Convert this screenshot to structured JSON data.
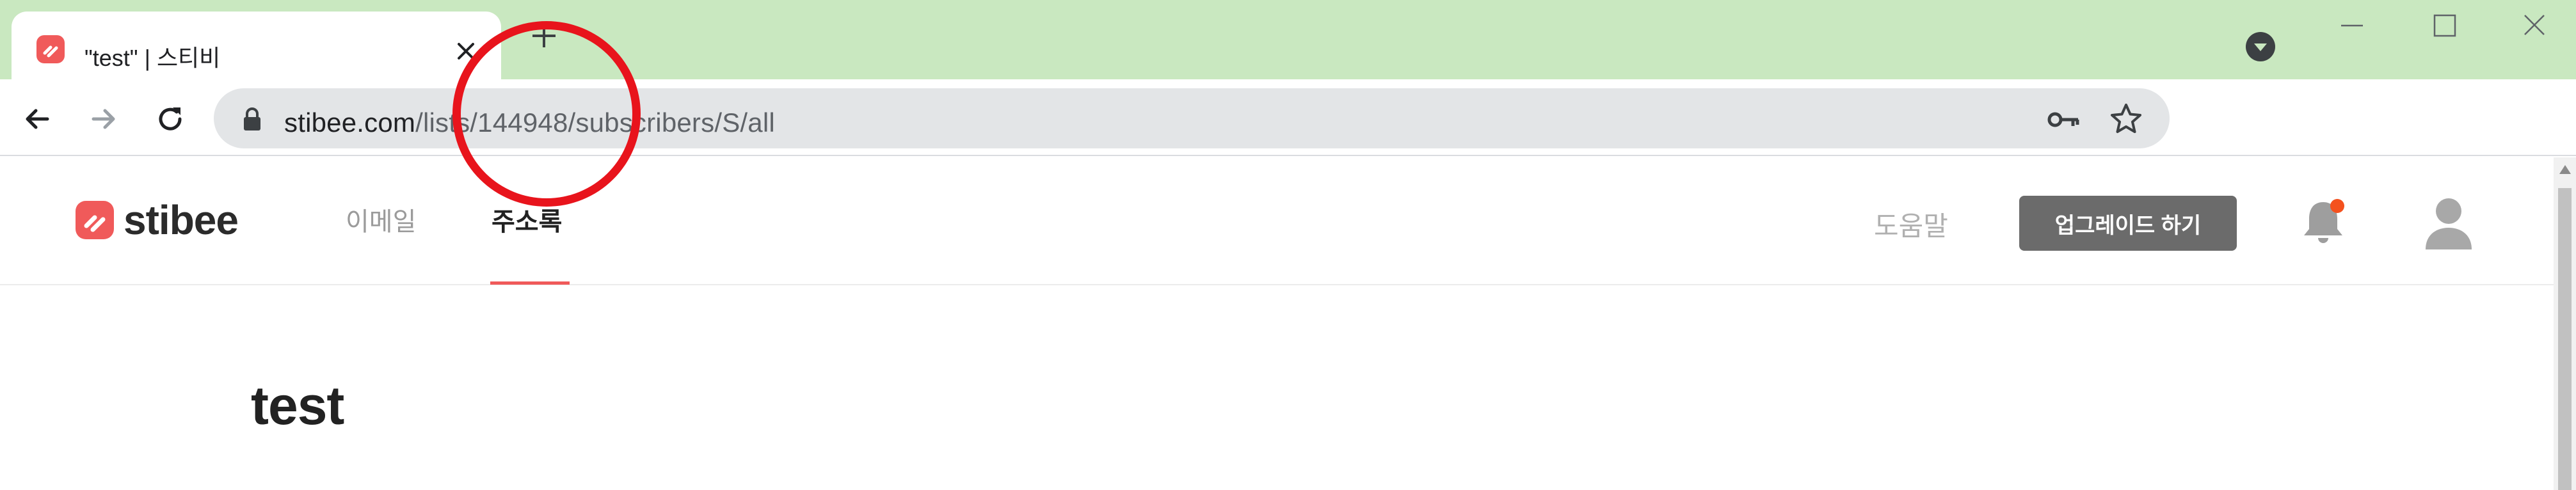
{
  "browser": {
    "tab": {
      "title": "\"test\" | 스티비",
      "favicon": "stibee-logo-icon"
    },
    "new_tab_label": "+",
    "address_bar": {
      "url_host": "stibee.com",
      "url_path": "/lists/144948/subscribers/S/all"
    },
    "icons": {
      "back": "arrow-left-icon",
      "forward": "arrow-right-icon",
      "reload": "reload-icon",
      "lock": "lock-icon",
      "key": "key-icon",
      "bookmark": "star-icon",
      "tab_search": "chevron-down-icon"
    },
    "colors": {
      "tabstrip_bg": "#c9e8c0",
      "omnibox_bg": "#e3e5e7"
    }
  },
  "annotation": {
    "shape": "circle",
    "color": "#e8141c"
  },
  "site": {
    "brand_name": "stibee",
    "brand_color": "#f05a5a",
    "nav": {
      "email": "이메일",
      "addressbook": "주소록"
    },
    "help_link": "도움말",
    "upgrade_button": "업그레이드 하기",
    "notification_dot_color": "#f4511e"
  },
  "page": {
    "title": "test"
  }
}
